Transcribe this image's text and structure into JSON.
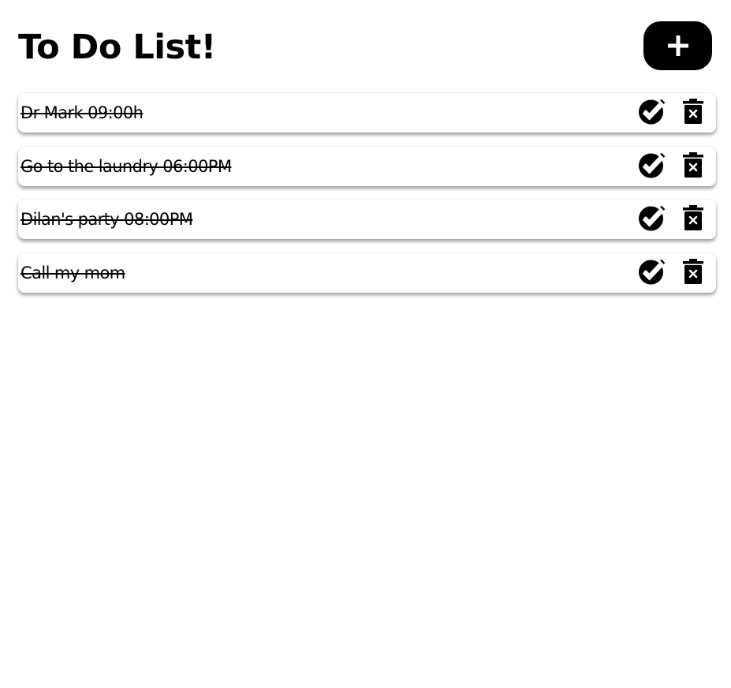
{
  "app": {
    "title": "To Do List!",
    "add_button": {
      "icon": "plus-icon"
    }
  },
  "todos": [
    {
      "text": "Dr Mark 09:00h",
      "completed": true
    },
    {
      "text": "Go to the laundry 06:00PM",
      "completed": true
    },
    {
      "text": "Dilan's party 08:00PM",
      "completed": true
    },
    {
      "text": "Call my mom",
      "completed": true
    }
  ],
  "icons": {
    "complete": "check-circle-icon",
    "delete": "trash-icon"
  },
  "colors": {
    "accent": "#000000",
    "background": "#ffffff",
    "card": "#ffffff"
  }
}
